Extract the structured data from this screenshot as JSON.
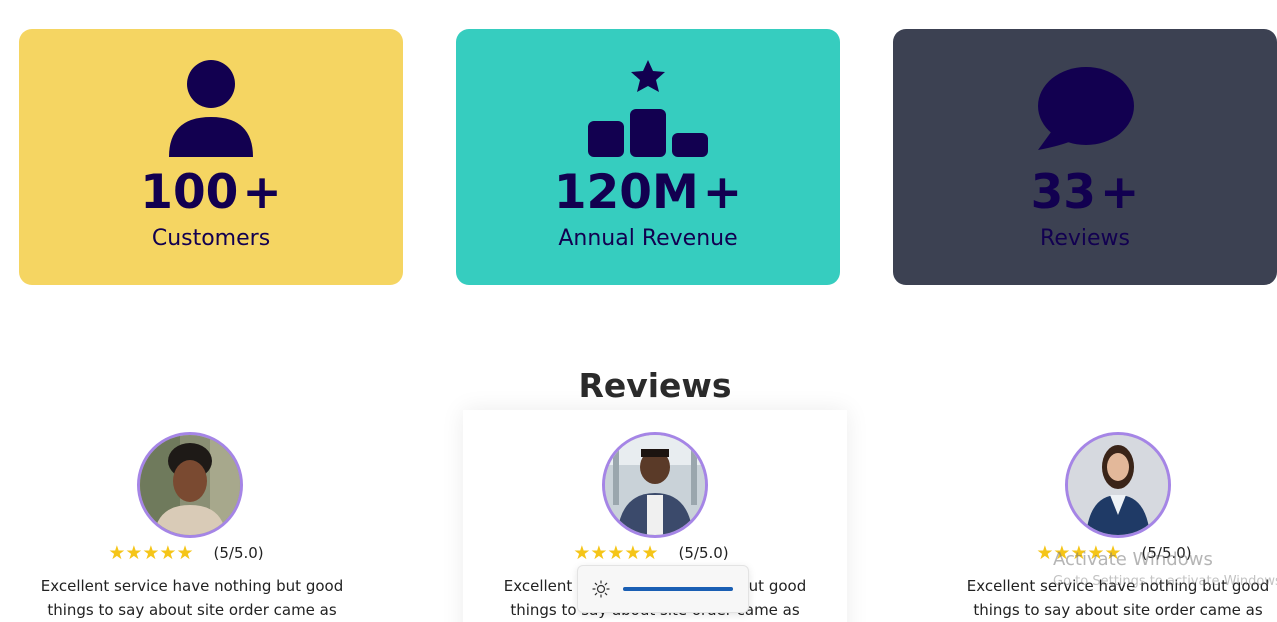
{
  "stats": [
    {
      "number": "100",
      "suffix": "+",
      "label": "Customers",
      "icon": "user-icon",
      "bg": "#f5d562"
    },
    {
      "number": "120M",
      "suffix": "+",
      "label": "Annual Revenue",
      "icon": "podium-star-icon",
      "bg": "#36cdbf"
    },
    {
      "number": "33",
      "suffix": "+",
      "label": "Reviews",
      "icon": "chat-bubble-icon",
      "bg": "#3c4152"
    }
  ],
  "colors": {
    "stat_text": "#120050",
    "avatar_border": "#a585e6",
    "star": "#f5c518",
    "brightness_fill": "#1a5fb4"
  },
  "reviews": {
    "heading": "Reviews",
    "items": [
      {
        "stars": "★★★★★",
        "rating": "(5/5.0)",
        "text": "Excellent service have nothing but good things to say about site order came as"
      },
      {
        "stars": "★★★★★",
        "rating": "(5/5.0)",
        "text": "Excellent service have nothing but good things to say about site order came as"
      },
      {
        "stars": "★★★★★",
        "rating": "(5/5.0)",
        "text": "Excellent service have nothing but good things to say about site order came as"
      }
    ]
  },
  "brightness": {
    "icon": "sun-icon",
    "level": 1.0
  },
  "watermark": {
    "title": "Activate Windows",
    "subtitle": "Go to Settings to activate Windows."
  }
}
